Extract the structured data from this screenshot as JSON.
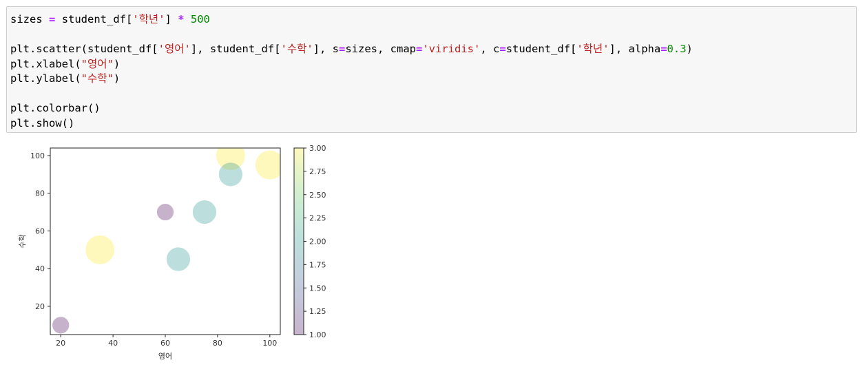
{
  "code": {
    "lines": [
      [
        {
          "t": "sizes",
          "c": "name"
        },
        {
          "t": " ",
          "c": "name"
        },
        {
          "t": "=",
          "c": "op"
        },
        {
          "t": " student_df[",
          "c": "name"
        },
        {
          "t": "'학년'",
          "c": "str"
        },
        {
          "t": "] ",
          "c": "name"
        },
        {
          "t": "*",
          "c": "op"
        },
        {
          "t": " ",
          "c": "name"
        },
        {
          "t": "500",
          "c": "num"
        }
      ],
      [],
      [
        {
          "t": "plt.scatter(student_df[",
          "c": "name"
        },
        {
          "t": "'영어'",
          "c": "str"
        },
        {
          "t": "], student_df[",
          "c": "name"
        },
        {
          "t": "'수학'",
          "c": "str"
        },
        {
          "t": "], s",
          "c": "name"
        },
        {
          "t": "=",
          "c": "op"
        },
        {
          "t": "sizes, cmap",
          "c": "name"
        },
        {
          "t": "=",
          "c": "op"
        },
        {
          "t": "'viridis'",
          "c": "str"
        },
        {
          "t": ", c",
          "c": "name"
        },
        {
          "t": "=",
          "c": "op"
        },
        {
          "t": "student_df[",
          "c": "name"
        },
        {
          "t": "'학년'",
          "c": "str"
        },
        {
          "t": "], alpha",
          "c": "name"
        },
        {
          "t": "=",
          "c": "op"
        },
        {
          "t": "0.3",
          "c": "num"
        },
        {
          "t": ")",
          "c": "name"
        }
      ],
      [
        {
          "t": "plt.xlabel(",
          "c": "name"
        },
        {
          "t": "\"영어\"",
          "c": "str"
        },
        {
          "t": ")",
          "c": "name"
        }
      ],
      [
        {
          "t": "plt.ylabel(",
          "c": "name"
        },
        {
          "t": "\"수학\"",
          "c": "str"
        },
        {
          "t": ")",
          "c": "name"
        }
      ],
      [],
      [
        {
          "t": "plt.colorbar()",
          "c": "name"
        }
      ],
      [
        {
          "t": "plt.show()",
          "c": "name"
        }
      ]
    ]
  },
  "colors": {
    "str": "#ba2121",
    "num": "#008800",
    "op": "#aa22ff",
    "name": "#000000",
    "cell_bg": "#f7f7f7",
    "cell_border": "#cfcfcf"
  },
  "chart_data": {
    "type": "scatter",
    "xlabel": "영어",
    "ylabel": "수학",
    "xlim": [
      16,
      104
    ],
    "ylim": [
      5,
      104
    ],
    "xticks": [
      20,
      40,
      60,
      80,
      100
    ],
    "yticks": [
      20,
      40,
      60,
      80,
      100
    ],
    "alpha": 0.3,
    "cmap": "viridis",
    "size_multiplier": 500,
    "points": [
      {
        "x": 20,
        "y": 10,
        "c": 1
      },
      {
        "x": 35,
        "y": 50,
        "c": 3
      },
      {
        "x": 60,
        "y": 70,
        "c": 1
      },
      {
        "x": 65,
        "y": 45,
        "c": 2
      },
      {
        "x": 75,
        "y": 70,
        "c": 2
      },
      {
        "x": 85,
        "y": 100,
        "c": 3
      },
      {
        "x": 85,
        "y": 90,
        "c": 2
      },
      {
        "x": 100,
        "y": 95,
        "c": 3
      }
    ],
    "colorbar": {
      "range": [
        1.0,
        3.0
      ],
      "ticks": [
        "1.00",
        "1.25",
        "1.50",
        "1.75",
        "2.00",
        "2.25",
        "2.50",
        "2.75",
        "3.00"
      ]
    }
  }
}
